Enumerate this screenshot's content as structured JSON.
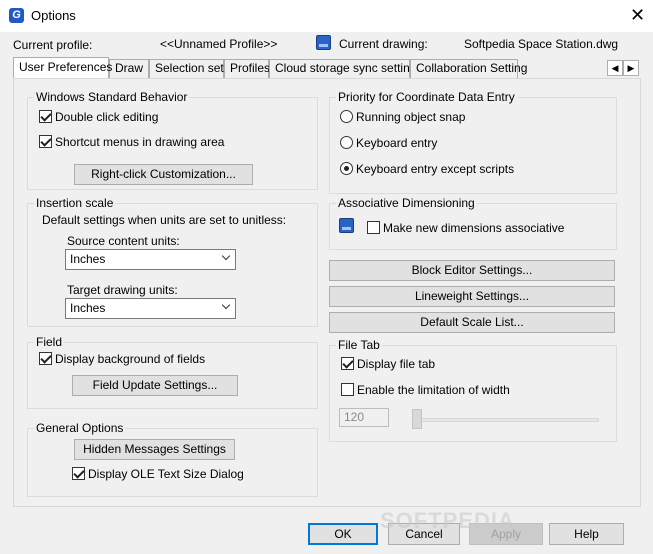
{
  "window": {
    "title": "Options",
    "close_glyph": "✕",
    "app_icon_letter": "G"
  },
  "header": {
    "current_profile_label": "Current profile:",
    "current_profile_value": "<<Unnamed Profile>>",
    "current_drawing_label": "Current drawing:",
    "current_drawing_value": "Softpedia Space Station.dwg"
  },
  "tabs": [
    {
      "label": "User Preferences",
      "active": true
    },
    {
      "label": "Draw"
    },
    {
      "label": "Selection set"
    },
    {
      "label": "Profiles"
    },
    {
      "label": "Cloud storage sync settings"
    },
    {
      "label": "Collaboration Setting"
    }
  ],
  "tab_scroll": {
    "left": "◀",
    "right": "▶"
  },
  "windows_standard": {
    "title": "Windows Standard Behavior",
    "double_click": {
      "label": "Double click editing",
      "checked": true
    },
    "shortcut_menus": {
      "label": "Shortcut menus in drawing area",
      "checked": true
    },
    "right_click_button": "Right-click Customization..."
  },
  "insertion_scale": {
    "title": "Insertion scale",
    "description": "Default settings when units are set to unitless:",
    "source_label": "Source content units:",
    "source_value": "Inches",
    "target_label": "Target drawing units:",
    "target_value": "Inches"
  },
  "field": {
    "title": "Field",
    "display_background": {
      "label": "Display background of fields",
      "checked": true
    },
    "update_button": "Field Update Settings..."
  },
  "general_options": {
    "title": "General Options",
    "hidden_messages_button": "Hidden Messages Settings",
    "display_ole": {
      "label": "Display OLE Text Size Dialog",
      "checked": true
    }
  },
  "priority": {
    "title": "Priority for Coordinate Data Entry",
    "options": [
      {
        "label": "Running object snap",
        "selected": false
      },
      {
        "label": "Keyboard entry",
        "selected": false
      },
      {
        "label": "Keyboard entry except scripts",
        "selected": true
      }
    ]
  },
  "associative": {
    "title": "Associative Dimensioning",
    "make_new": {
      "label": "Make new dimensions associative",
      "checked": false
    }
  },
  "right_buttons": {
    "block_editor": "Block Editor Settings...",
    "lineweight": "Lineweight Settings...",
    "default_scale": "Default Scale List..."
  },
  "file_tab": {
    "title": "File Tab",
    "display_file_tab": {
      "label": "Display file tab",
      "checked": true
    },
    "enable_limitation": {
      "label": "Enable the limitation of width",
      "checked": false
    },
    "width_value": "120"
  },
  "footer": {
    "ok": "OK",
    "cancel": "Cancel",
    "apply": "Apply",
    "help": "Help"
  },
  "watermark": "SOFTPEDIA",
  "colors": {
    "accent": "#0078d7",
    "dialog_bg": "#f0f0f0"
  }
}
